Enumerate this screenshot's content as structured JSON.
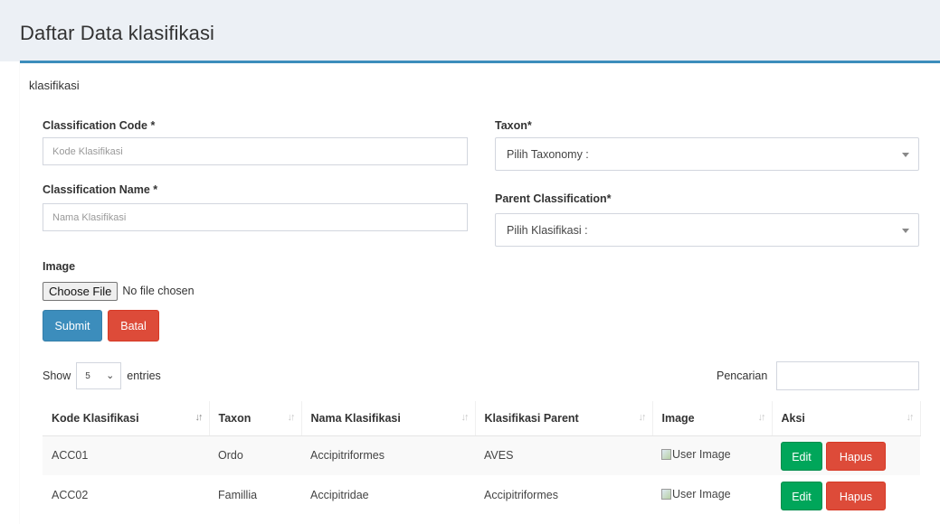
{
  "header": {
    "title": "Daftar Data klasifikasi"
  },
  "form": {
    "box_title": "klasifikasi",
    "code": {
      "label": "Classification Code *",
      "placeholder": "Kode Klasifikasi"
    },
    "name": {
      "label": "Classification Name *",
      "placeholder": "Nama Klasifikasi"
    },
    "taxon": {
      "label": "Taxon*",
      "selected": "Pilih Taxonomy :"
    },
    "parent": {
      "label": "Parent Classification*",
      "selected": "Pilih Klasifikasi :"
    },
    "image": {
      "label": "Image",
      "choose_label": "Choose File",
      "status": "No file chosen"
    },
    "submit_label": "Submit",
    "cancel_label": "Batal"
  },
  "table_controls": {
    "show_label": "Show",
    "entries_value": "5",
    "entries_label": "entries",
    "search_label": "Pencarian"
  },
  "table": {
    "columns": [
      "Kode Klasifikasi",
      "Taxon",
      "Nama Klasifikasi",
      "Klasifikasi Parent",
      "Image",
      "Aksi"
    ],
    "rows": [
      {
        "code": "ACC01",
        "taxon": "Ordo",
        "name": "Accipitriformes",
        "parent": "AVES",
        "image_alt": "User Image"
      },
      {
        "code": "ACC02",
        "taxon": "Famillia",
        "name": "Accipitridae",
        "parent": "Accipitriformes",
        "image_alt": "User Image"
      }
    ],
    "edit_label": "Edit",
    "delete_label": "Hapus"
  },
  "colors": {
    "primary": "#3c8dbc",
    "danger": "#dd4b39",
    "success": "#00a65a",
    "header_bg": "#ecf0f5"
  }
}
